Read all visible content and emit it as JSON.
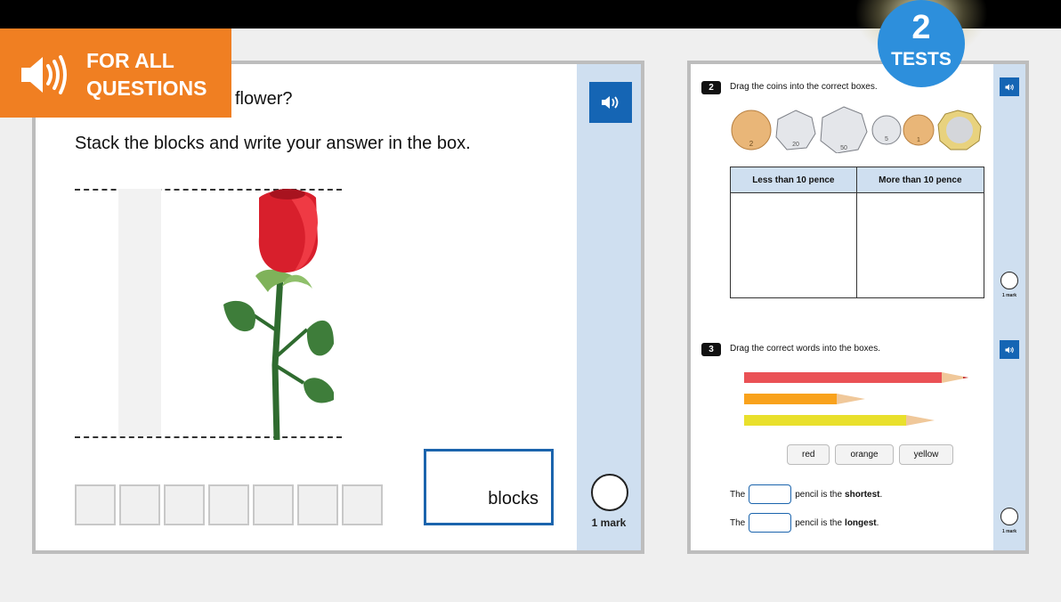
{
  "banner": {
    "line1": "FOR ALL",
    "line2": "QUESTIONS",
    "icon": "speaker-icon",
    "color": "#f07f22"
  },
  "badge": {
    "number": "2",
    "label": "TESTS",
    "color": "#2d8fdc"
  },
  "left_question": {
    "title_visible": "flower?",
    "instruction": "Stack the blocks and write your answer in the box.",
    "blocks_count": 7,
    "answer": {
      "value": "",
      "unit": "blocks"
    },
    "mark_label": "1 mark",
    "audio_icon": "speaker-icon"
  },
  "right_page": {
    "q2": {
      "number": "2",
      "prompt": "Drag the coins into the correct boxes.",
      "coins": [
        "2p",
        "20p",
        "50p",
        "5p",
        "1p",
        "£1"
      ],
      "table_headers": [
        "Less than 10 pence",
        "More than 10 pence"
      ],
      "mark_label": "1 mark"
    },
    "q3": {
      "number": "3",
      "prompt": "Drag the correct words into the boxes.",
      "pencils": [
        "red",
        "orange",
        "yellow"
      ],
      "word_chips": [
        "red",
        "orange",
        "yellow"
      ],
      "sentence1": {
        "pre": "The",
        "post": "pencil is the",
        "bold": "shortest",
        "end": "."
      },
      "sentence2": {
        "pre": "The",
        "post": "pencil is the",
        "bold": "longest",
        "end": "."
      },
      "mark_label": "1 mark"
    }
  },
  "colors": {
    "side_panel": "#cfdff0",
    "audio_button": "#1565b4",
    "answer_border": "#1b64ad"
  }
}
